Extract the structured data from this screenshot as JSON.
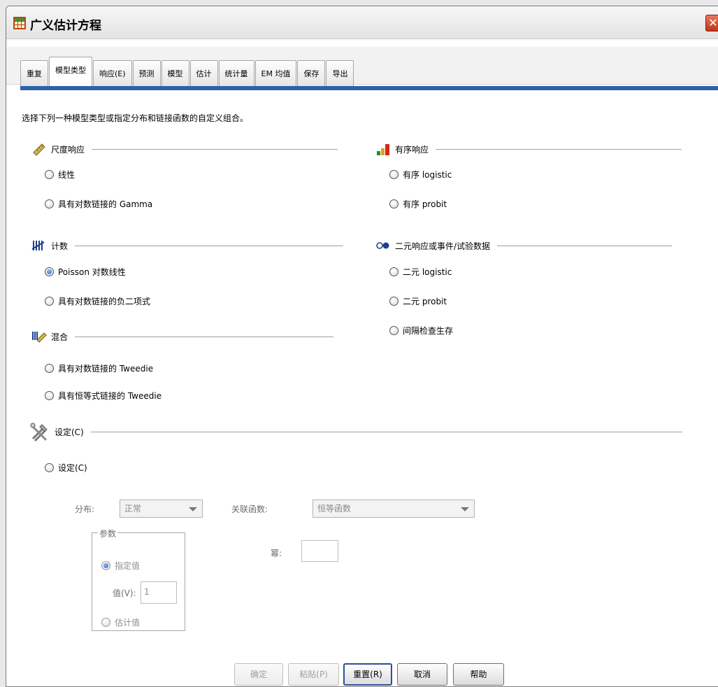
{
  "window": {
    "title": "广义估计方程",
    "close_glyph": "✕"
  },
  "tabs": [
    {
      "label": "重复",
      "active": false
    },
    {
      "label": "模型类型",
      "active": true
    },
    {
      "label": "响应(E)",
      "active": false
    },
    {
      "label": "预测",
      "active": false
    },
    {
      "label": "模型",
      "active": false
    },
    {
      "label": "估计",
      "active": false
    },
    {
      "label": "统计量",
      "active": false
    },
    {
      "label": "EM 均值",
      "active": false
    },
    {
      "label": "保存",
      "active": false
    },
    {
      "label": "导出",
      "active": false
    }
  ],
  "description": "选择下列一种模型类型或指定分布和链接函数的自定义组合。",
  "groups": {
    "scale": {
      "title": "尺度响应",
      "icon": "ruler-icon",
      "options": [
        {
          "label": "线性",
          "checked": false
        },
        {
          "label": "具有对数链接的 Gamma",
          "checked": false
        }
      ]
    },
    "ordinal": {
      "title": "有序响应",
      "icon": "ordinal-bars-icon",
      "options": [
        {
          "label": "有序 logistic",
          "checked": false
        },
        {
          "label": "有序 probit",
          "checked": false
        }
      ]
    },
    "count": {
      "title": "计数",
      "icon": "tally-icon",
      "options": [
        {
          "label": "Poisson 对数线性",
          "checked": true
        },
        {
          "label": "具有对数链接的负二项式",
          "checked": false
        }
      ]
    },
    "binary": {
      "title": "二元响应或事件/试验数据",
      "icon": "binary-toggle-icon",
      "options": [
        {
          "label": "二元 logistic",
          "checked": false
        },
        {
          "label": "二元 probit",
          "checked": false
        },
        {
          "label": "间隔检查生存",
          "checked": false
        }
      ]
    },
    "mixture": {
      "title": "混合",
      "icon": "mixture-icon",
      "options": [
        {
          "label": "具有对数链接的 Tweedie",
          "checked": false
        },
        {
          "label": "具有恒等式链接的 Tweedie",
          "checked": false
        }
      ]
    },
    "custom": {
      "title": "设定(C)",
      "icon": "tools-icon",
      "option": {
        "label": "设定(C)",
        "checked": false
      }
    }
  },
  "custom_fields": {
    "distribution_label": "分布:",
    "distribution_value": "正常",
    "link_label": "关联函数:",
    "link_value": "恒等函数",
    "parameter_title": "参数",
    "specify_value_label": "指定值",
    "value_label": "值(V):",
    "value": "1",
    "estimate_value_label": "估计值",
    "power_label": "幂:",
    "power_value": ""
  },
  "buttons": {
    "ok": "确定",
    "paste": "粘贴(P)",
    "reset": "重置(R)",
    "cancel": "取消",
    "help": "帮助"
  }
}
